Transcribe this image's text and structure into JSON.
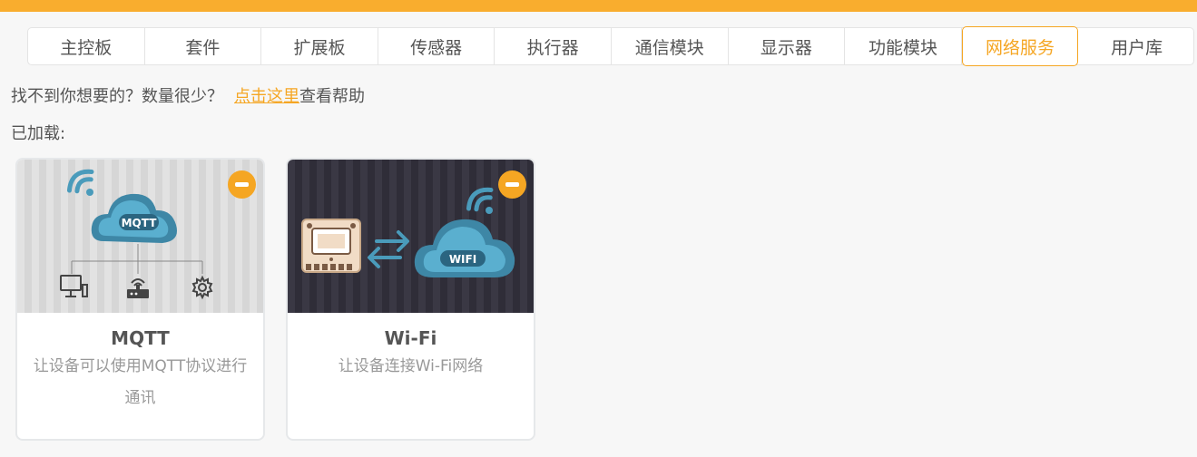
{
  "colors": {
    "accent": "#f9ad2e",
    "active_tab": "#f5a623"
  },
  "tabs": [
    {
      "label": "主控板"
    },
    {
      "label": "套件"
    },
    {
      "label": "扩展板"
    },
    {
      "label": "传感器"
    },
    {
      "label": "执行器"
    },
    {
      "label": "通信模块"
    },
    {
      "label": "显示器"
    },
    {
      "label": "功能模块"
    },
    {
      "label": "网络服务",
      "active": true
    },
    {
      "label": "用户库"
    }
  ],
  "help": {
    "prefix": "找不到你想要的？数量很少？",
    "link": "点击这里",
    "suffix": "查看帮助"
  },
  "loaded_label": "已加载:",
  "cards": [
    {
      "title": "MQTT",
      "desc": "让设备可以使用MQTT协议进行通讯",
      "image_text": "MQTT",
      "icons": [
        "wifi-icon",
        "cloud-icon",
        "computer-icon",
        "router-icon",
        "gear-icon",
        "minus-icon"
      ]
    },
    {
      "title": "Wi-Fi",
      "desc": "让设备连接Wi-Fi网络",
      "image_text": "WIFI",
      "icons": [
        "board-icon",
        "swap-arrows-icon",
        "cloud-icon",
        "wifi-icon",
        "minus-icon"
      ]
    }
  ]
}
